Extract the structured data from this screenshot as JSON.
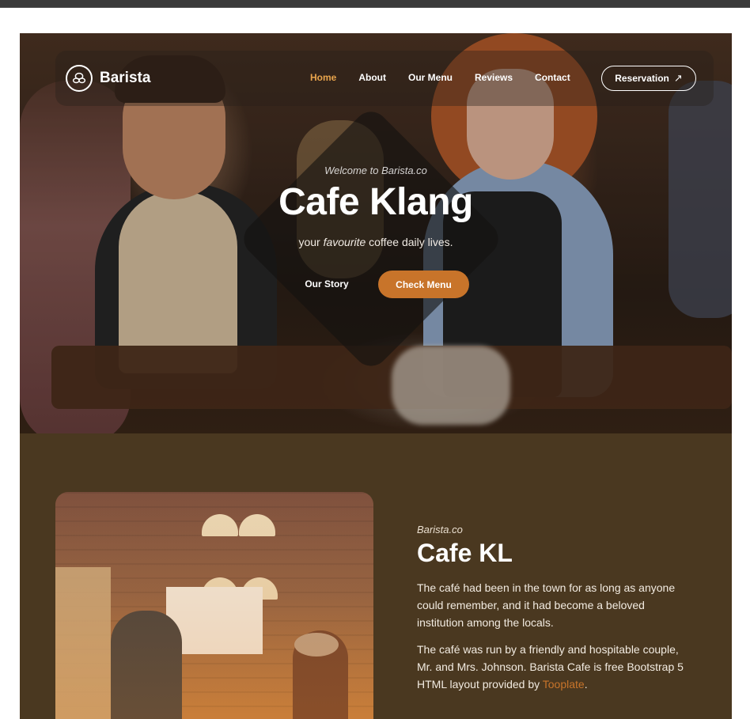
{
  "nav": {
    "brand": "Barista",
    "links": [
      {
        "label": "Home",
        "active": true
      },
      {
        "label": "About",
        "active": false
      },
      {
        "label": "Our Menu",
        "active": false
      },
      {
        "label": "Reviews",
        "active": false
      },
      {
        "label": "Contact",
        "active": false
      }
    ],
    "reservation_label": "Reservation",
    "reservation_icon": "arrow-up-right-icon"
  },
  "hero": {
    "welcome": "Welcome to Barista.co",
    "title": "Cafe Klang",
    "tagline_before": "your ",
    "tagline_em": "favourite",
    "tagline_after": " coffee daily lives.",
    "our_story_label": "Our Story",
    "check_menu_label": "Check Menu"
  },
  "about": {
    "kicker": "Barista.co",
    "title": "Cafe KL",
    "paragraph1": "The café had been in the town for as long as anyone could remember, and it had become a beloved institution among the locals.",
    "paragraph2_text": "The café was run by a friendly and hospitable couple, Mr. and Mrs. Johnson. Barista Cafe is free Bootstrap 5 HTML layout provided by ",
    "paragraph2_link": "Tooplate",
    "paragraph2_end": "."
  },
  "colors": {
    "accent": "#c8742a",
    "nav_active": "#e8a44c",
    "about_bg": "#4a3820"
  }
}
